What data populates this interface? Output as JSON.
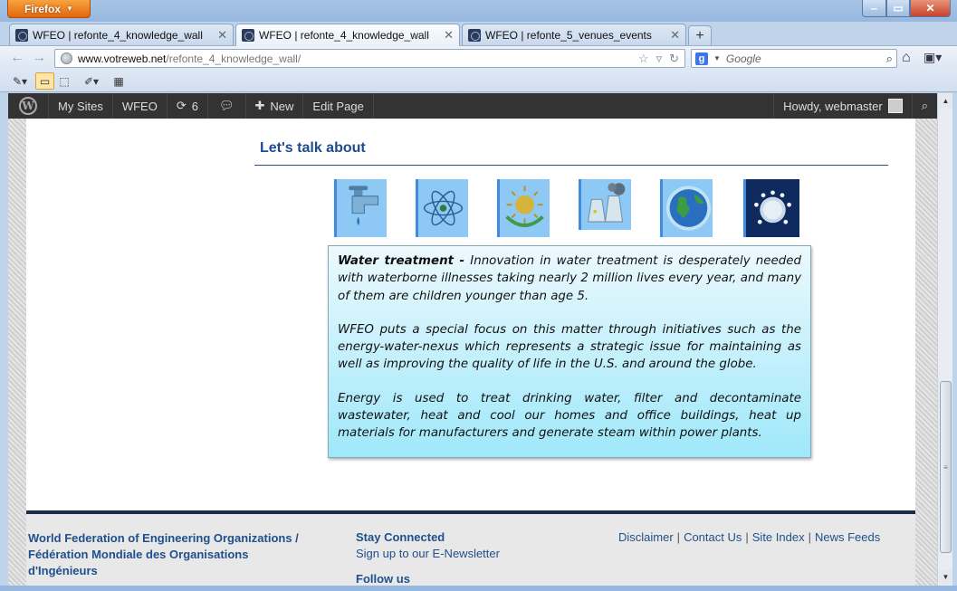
{
  "browser": {
    "app_button": "Firefox",
    "tabs": [
      {
        "label": "WFEO | refonte_4_knowledge_wall"
      },
      {
        "label": "WFEO | refonte_4_knowledge_wall"
      },
      {
        "label": "WFEO | refonte_5_venues_events"
      }
    ],
    "url_domain": "www.votreweb.net",
    "url_path": "/refonte_4_knowledge_wall/",
    "search_placeholder": "Google"
  },
  "adminbar": {
    "my_sites": "My Sites",
    "site": "WFEO",
    "updates": "6",
    "new": "New",
    "edit_page": "Edit Page",
    "howdy": "Howdy, webmaster"
  },
  "content": {
    "section_title": "Let's talk about",
    "topics": [
      {
        "icon": "water-tap-icon"
      },
      {
        "icon": "atom-icon"
      },
      {
        "icon": "recycle-sun-icon"
      },
      {
        "icon": "power-plant-icon"
      },
      {
        "icon": "earth-globe-icon"
      },
      {
        "icon": "people-globe-icon"
      }
    ],
    "info": {
      "heading": "Water treatment -",
      "p1_rest": " Innovation in water treatment is desperately needed with waterborne illnesses taking nearly 2 million lives every year, and many of them are children younger than age 5.",
      "p2": "WFEO puts a special focus on this matter through initiatives such as the energy-water-nexus which represents a strategic issue for maintaining as well as improving the quality of life in the U.S. and around the globe.",
      "p3": "Energy is used to treat drinking water, filter and decontaminate wastewater, heat and cool our homes and office buildings, heat up materials for manufacturers and generate steam within power plants."
    }
  },
  "footer": {
    "org": "World Federation of Engineering Organizations / Fédération Mondiale des Organisations d'Ingénieurs",
    "stay_connected": "Stay Connected",
    "signup": "Sign up to our E-Newsletter",
    "follow": "Follow us",
    "links": [
      "Disclaimer",
      "Contact Us",
      "Site Index",
      "News Feeds"
    ]
  }
}
